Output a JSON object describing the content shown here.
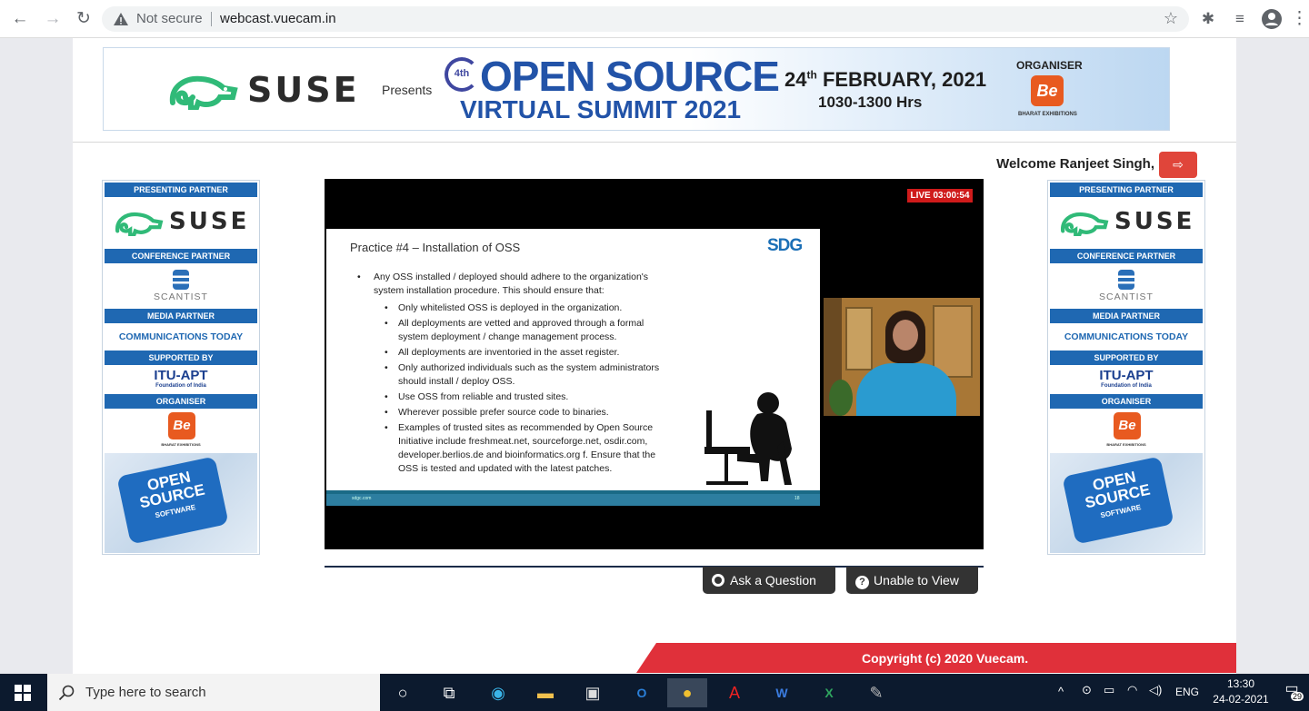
{
  "browser": {
    "security": "Not secure",
    "url": "webcast.vuecam.in"
  },
  "banner": {
    "brand": "SUSE",
    "presents": "Presents",
    "edition": "4th",
    "title1": "OPEN SOURCE",
    "title2": "VIRTUAL SUMMIT 2021",
    "date_day": "24",
    "date_sup": "th",
    "date_rest": "FEBRUARY, 2021",
    "time": "1030-1300 Hrs",
    "organiser": "ORGANISER",
    "org_name": "BHARAT EXHIBITIONS",
    "org_logo": "Be"
  },
  "user": {
    "welcome": "Welcome Ranjeet Singh,"
  },
  "sidebar": {
    "presenting": "PRESENTING PARTNER",
    "suse": "SUSE",
    "conference": "CONFERENCE PARTNER",
    "scantist": "SCANTIST",
    "media": "MEDIA PARTNER",
    "comms": "COMMUNICATIONS TODAY",
    "supported": "SUPPORTED BY",
    "itu": "ITU-APT",
    "itu_sub": "Foundation of India",
    "organiser": "ORGANISER",
    "org_logo": "Be",
    "org_name": "BHARAT EXHIBITIONS",
    "puzzle1": "OPEN",
    "puzzle2": "SOURCE",
    "puzzle3": "SOFTWARE"
  },
  "video": {
    "live": "LIVE 03:00:54"
  },
  "slide": {
    "title": "Practice #4 – Installation of OSS",
    "logo": "SDG",
    "bullet_lines": [
      "Any OSS installed / deployed should adhere to the organization's",
      "system installation procedure. This should ensure that:"
    ],
    "sub": [
      [
        "Only whitelisted OSS is deployed in the organization."
      ],
      [
        "All deployments are vetted and approved through a formal",
        "system deployment / change management process."
      ],
      [
        "All deployments are inventoried in the asset register."
      ],
      [
        "Only authorized individuals such as the system administrators",
        "should install / deploy OSS."
      ],
      [
        "Use OSS from reliable and trusted sites."
      ],
      [
        "Wherever possible prefer source code to binaries."
      ],
      [
        "Examples of trusted sites as recommended by Open Source",
        "Initiative include freshmeat.net, sourceforge.net, osdir.com,",
        "developer.berlios.de and bioinformatics.org f. Ensure that the",
        "OSS is tested and updated with the latest patches."
      ]
    ],
    "footer_left": "sdgc.com",
    "footer_right": "18"
  },
  "actions": {
    "ask": "Ask a Question",
    "unable": "Unable to View"
  },
  "footer": {
    "copyright": "Copyright (c) 2020 Vuecam."
  },
  "taskbar": {
    "search_placeholder": "Type here to search",
    "lang": "ENG",
    "time": "13:30",
    "date": "24-02-2021",
    "notif": "29"
  }
}
